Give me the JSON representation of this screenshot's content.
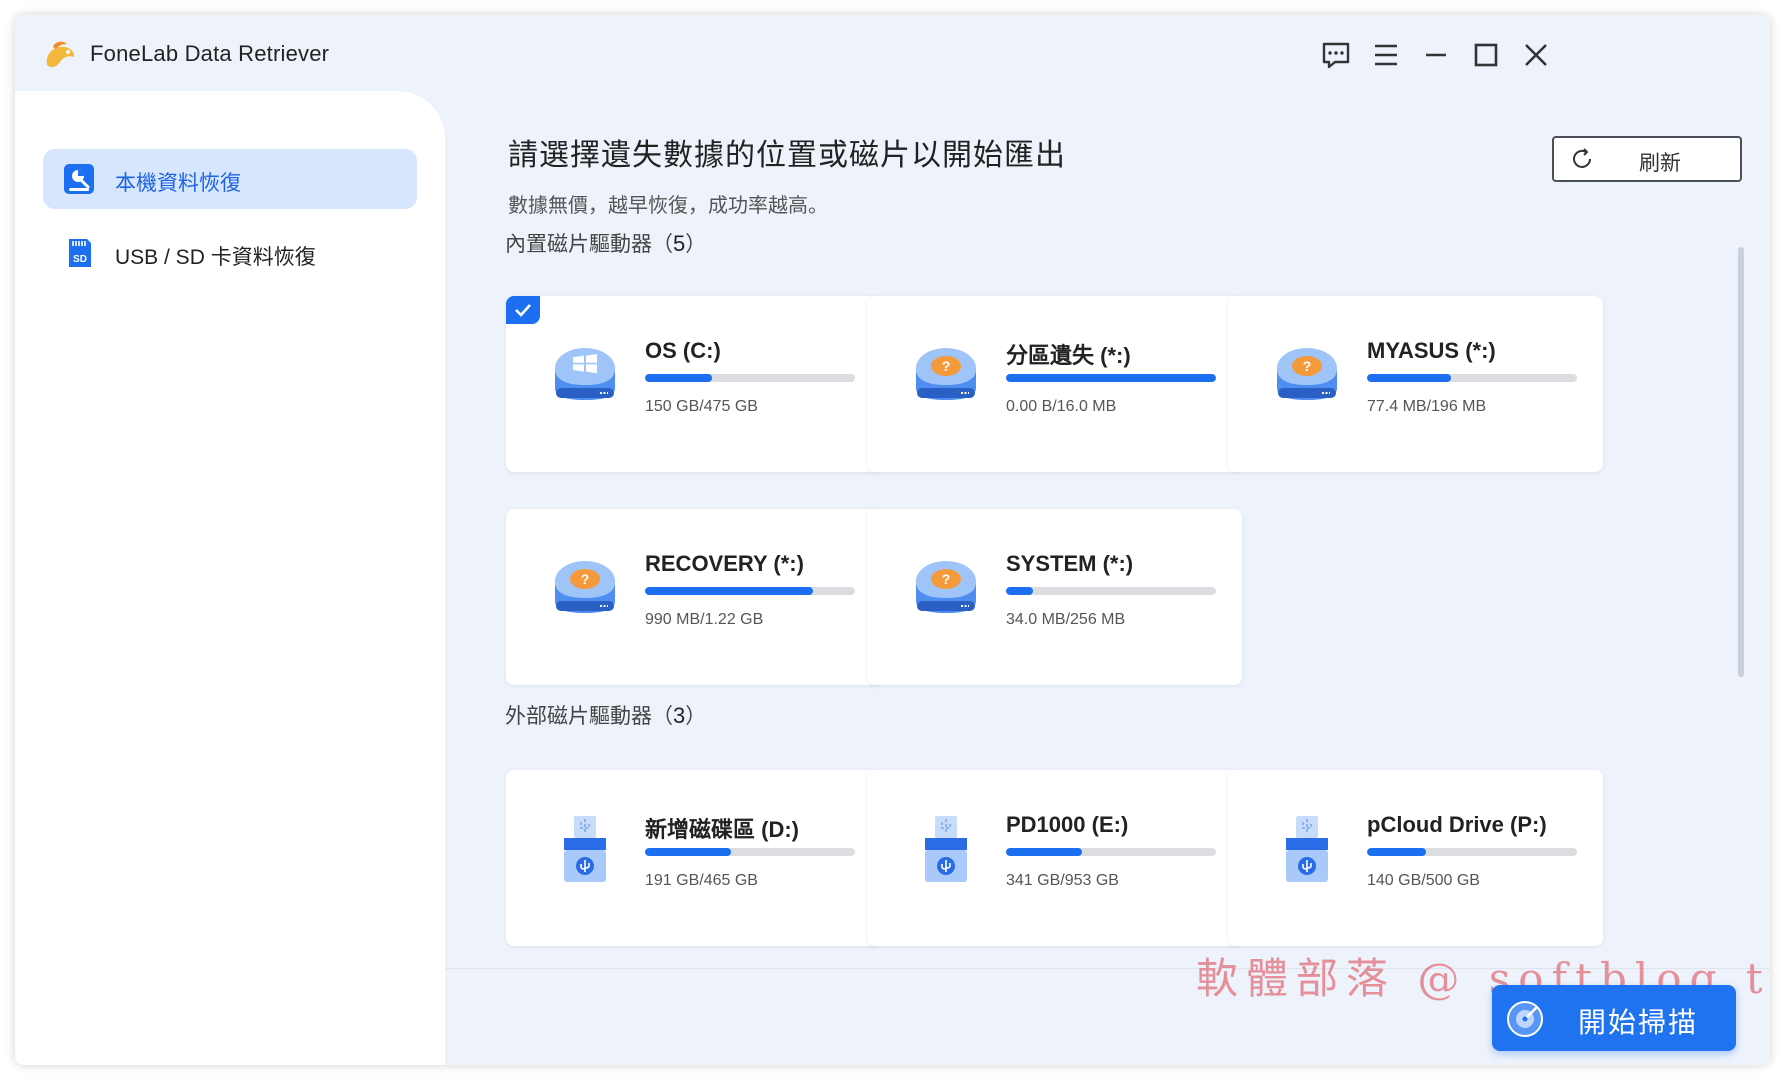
{
  "app": {
    "title": "FoneLab Data Retriever"
  },
  "sidebar": {
    "items": [
      {
        "label": "本機資料恢復",
        "active": true,
        "icon": "computer-recovery-icon"
      },
      {
        "label": "USB / SD 卡資料恢復",
        "active": false,
        "icon": "sd-card-icon"
      }
    ]
  },
  "main": {
    "title": "請選擇遺失數據的位置或磁片以開始匯出",
    "subtitle": "數據無價，越早恢復，成功率越高。",
    "refresh_label": "刷新"
  },
  "internal": {
    "label": "內置磁片驅動器（",
    "count": "5",
    "close": "）",
    "drives": [
      {
        "name": "OS (C:)",
        "size": "150 GB/475 GB",
        "usage": 0.32,
        "icon": "windows-drive-icon",
        "selected": true
      },
      {
        "name": "分區遺失 (*:)",
        "size": "0.00  B/16.0 MB",
        "usage": 1.0,
        "icon": "unknown-drive-icon",
        "selected": false
      },
      {
        "name": "MYASUS (*:)",
        "size": "77.4 MB/196 MB",
        "usage": 0.4,
        "icon": "unknown-drive-icon",
        "selected": false
      },
      {
        "name": "RECOVERY (*:)",
        "size": "990 MB/1.22 GB",
        "usage": 0.8,
        "icon": "unknown-drive-icon",
        "selected": false
      },
      {
        "name": "SYSTEM (*:)",
        "size": "34.0 MB/256 MB",
        "usage": 0.13,
        "icon": "unknown-drive-icon",
        "selected": false
      }
    ]
  },
  "external": {
    "label": "外部磁片驅動器（",
    "count": "3",
    "close": "）",
    "drives": [
      {
        "name": "新增磁碟區 (D:)",
        "size": "191 GB/465 GB",
        "usage": 0.41,
        "icon": "usb-drive-icon"
      },
      {
        "name": "PD1000 (E:)",
        "size": "341 GB/953 GB",
        "usage": 0.36,
        "icon": "usb-drive-icon"
      },
      {
        "name": "pCloud Drive (P:)",
        "size": "140 GB/500 GB",
        "usage": 0.28,
        "icon": "usb-drive-icon"
      }
    ]
  },
  "footer": {
    "scan_label": "開始掃描",
    "watermark": "軟體部落 @ softblog.tw"
  },
  "colors": {
    "accent": "#1b6ff0",
    "sidebar_active": "#d7e5fd",
    "background": "#eef3fb"
  }
}
